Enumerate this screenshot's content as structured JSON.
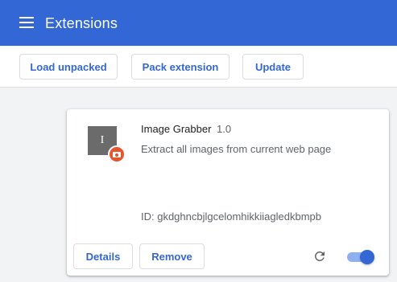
{
  "header": {
    "menu_icon": "hamburger-menu-icon",
    "title": "Extensions",
    "background_color": "#3367d6"
  },
  "toolbar": {
    "load_unpacked_label": "Load unpacked",
    "pack_extension_label": "Pack extension",
    "update_label": "Update"
  },
  "extension": {
    "icon_letter": "I",
    "icon_badge": "camera-badge-icon",
    "name": "Image Grabber",
    "version": "1.0",
    "description": "Extract all images from current web page",
    "id_text": "ID: gkdghncbjlgcelomhikkiiagledkbmpb",
    "details_label": "Details",
    "remove_label": "Remove",
    "reload_icon": "reload-icon",
    "enabled": true,
    "accent_color": "#3367d6"
  }
}
